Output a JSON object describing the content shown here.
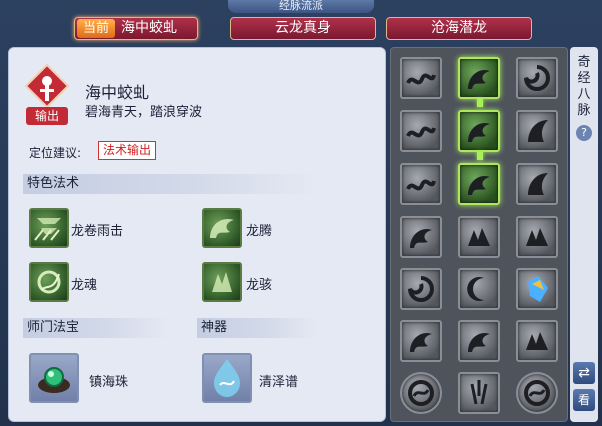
{
  "window": {
    "title": "经脉流派"
  },
  "tabs": [
    {
      "prefix": "当前",
      "label": "海中蛟虬",
      "selected": true
    },
    {
      "label": "云龙真身",
      "selected": false
    },
    {
      "label": "沧海潜龙",
      "selected": false
    }
  ],
  "faction": {
    "name": "海中蛟虬",
    "motto": "碧海青天，踏浪穿波",
    "badge": "输出",
    "role_label": "定位建议:",
    "role_value": "法术输出"
  },
  "sections": {
    "skills": "特色法术",
    "weapon": "师门法宝",
    "artifact": "神器"
  },
  "skills": [
    {
      "name": "龙卷雨击",
      "icon": "tornado-rain-icon"
    },
    {
      "name": "龙腾",
      "icon": "dragon-soar-icon"
    },
    {
      "name": "龙魂",
      "icon": "dragon-soul-icon"
    },
    {
      "name": "龙骇",
      "icon": "dragon-terror-icon"
    }
  ],
  "treasure": {
    "name": "镇海珠",
    "icon": "pearl-treasure-icon"
  },
  "artifact": {
    "name": "清泽谱",
    "icon": "water-artifact-icon"
  },
  "meridian": {
    "rows": [
      [
        "wave",
        "dragon",
        "swirl"
      ],
      [
        "wave",
        "dragon",
        "horn"
      ],
      [
        "wave",
        "dragon",
        "horn"
      ],
      [
        "dragon",
        "claw",
        "claw"
      ],
      [
        "swirl",
        "moon",
        "crystal"
      ],
      [
        "dragon",
        "dragon",
        "claw"
      ],
      [
        "orb",
        "tentacle",
        "orb"
      ]
    ],
    "active": [
      [
        0,
        1
      ],
      [
        1,
        1
      ],
      [
        2,
        1
      ]
    ]
  },
  "sidebar": {
    "title": "奇经八脉",
    "help": "?",
    "swap": "⇄",
    "view": "看"
  },
  "colors": {
    "active_glow": "#a6f05a",
    "tab_red": "#b0304a",
    "current_orange": "#f08a2a",
    "role_red": "#d02020"
  }
}
